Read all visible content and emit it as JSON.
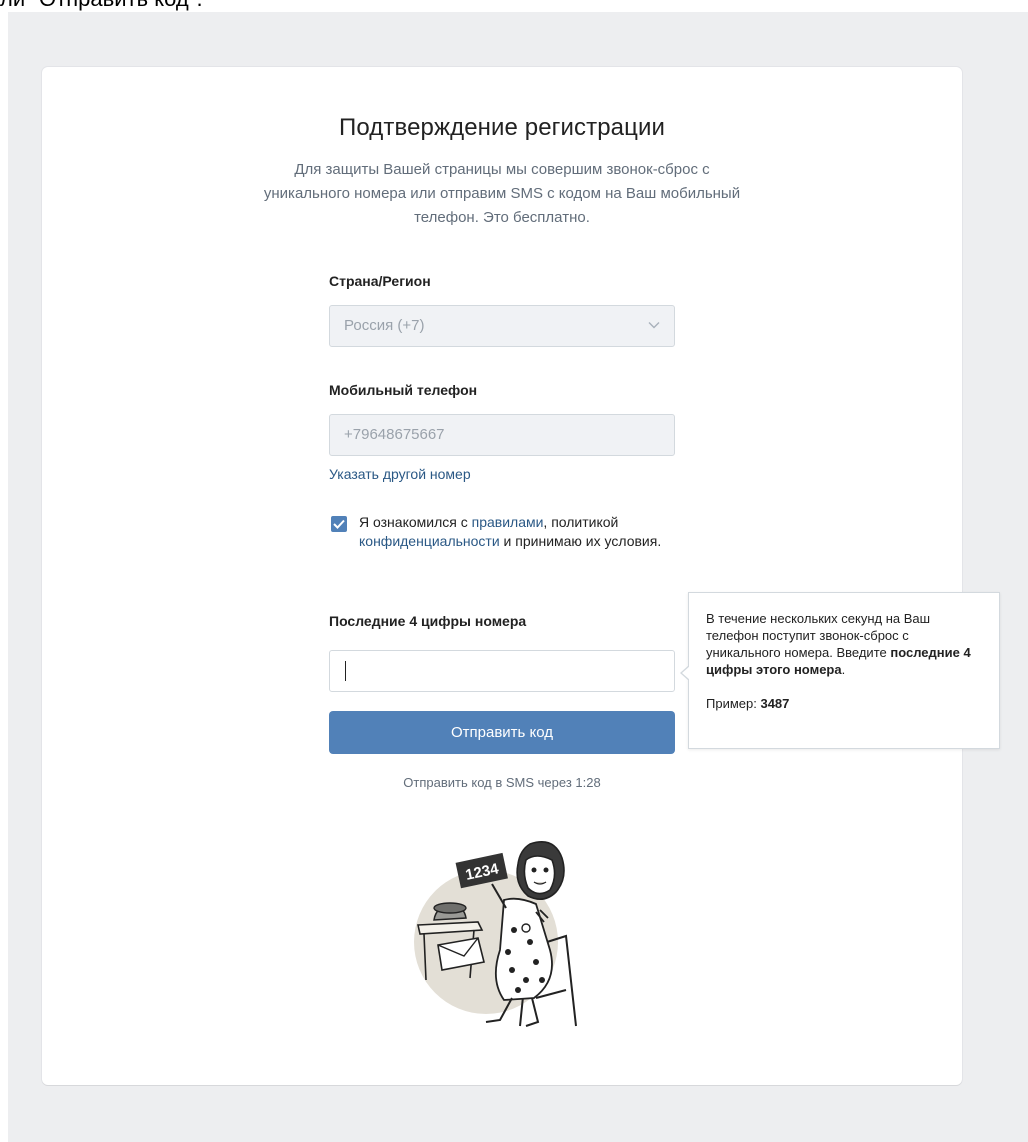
{
  "caption": "ли \"Отправить код\".",
  "title": "Подтверждение регистрации",
  "description": "Для защиты Вашей страницы мы совершим звонок-сброс с уникального номера или отправим SMS с кодом на Ваш мобильный телефон. Это бесплатно.",
  "country": {
    "label": "Страна/Регион",
    "value": "Россия (+7)"
  },
  "phone": {
    "label": "Мобильный телефон",
    "value": "+79648675667"
  },
  "change_number_link": "Указать другой номер",
  "terms": {
    "checked": true,
    "part1": "Я ознакомился с ",
    "rules_link": "правилами",
    "part2": ", политикой ",
    "privacy_link": "конфиденциальности",
    "part3": " и принимаю их условия."
  },
  "code": {
    "label": "Последние 4 цифры номера",
    "value": ""
  },
  "submit_label": "Отправить код",
  "sms_timer": "Отправить код в SMS через 1:28",
  "tooltip": {
    "text_part1": "В течение нескольких секунд на Ваш телефон поступит звонок-сброс с уникального номера. Введите ",
    "text_bold": "последние 4 цифры этого номера",
    "text_part2": ".",
    "example_label": "Пример: ",
    "example_value": "3487"
  },
  "illustration": {
    "sign_text": "1234"
  },
  "colors": {
    "accent": "#5181b8",
    "link": "#2a5885",
    "background": "#edeef0"
  }
}
